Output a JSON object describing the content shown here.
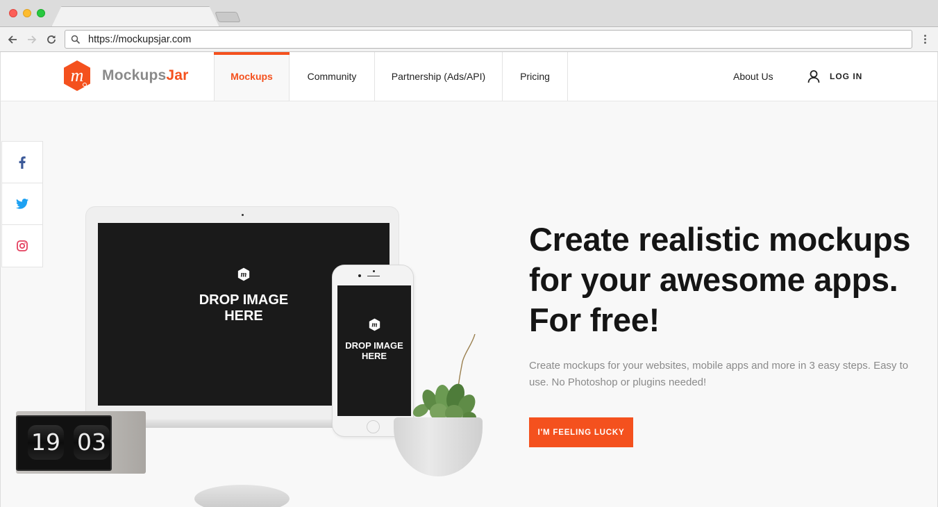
{
  "browser": {
    "url": "https://mockupsjar.com",
    "back_label": "Back",
    "forward_label": "Forward",
    "reload_label": "Reload"
  },
  "header": {
    "logo": {
      "part1": "Mockups",
      "part2": "Jar"
    },
    "nav": [
      {
        "label": "Mockups",
        "active": true
      },
      {
        "label": "Community",
        "active": false
      },
      {
        "label": "Partnership (Ads/API)",
        "active": false
      },
      {
        "label": "Pricing",
        "active": false
      }
    ],
    "about_label": "About Us",
    "login_label": "LOG IN"
  },
  "social": [
    {
      "name": "facebook",
      "icon": "facebook-icon",
      "color": "#3b5998"
    },
    {
      "name": "twitter",
      "icon": "twitter-icon",
      "color": "#1da1f2"
    },
    {
      "name": "instagram",
      "icon": "instagram-icon",
      "color": "#e4405f"
    }
  ],
  "hero": {
    "headline_lines": [
      "Create realistic mockups",
      "for your awesome apps.",
      "For free!"
    ],
    "subtext": "Create mockups for your websites, mobile apps and more in 3 easy steps. Easy to use. No Photoshop or plugins needed!",
    "cta_label": "I'M FEELING LUCKY",
    "laptop_drop": [
      "DROP IMAGE",
      "HERE"
    ],
    "phone_drop": [
      "DROP IMAGE",
      "HERE"
    ],
    "clock": {
      "hours": "19",
      "minutes": "03"
    }
  },
  "colors": {
    "accent": "#f4511e",
    "text_dark": "#151515",
    "text_muted": "#8a8a8a",
    "hero_bg": "#f8f8f8"
  }
}
